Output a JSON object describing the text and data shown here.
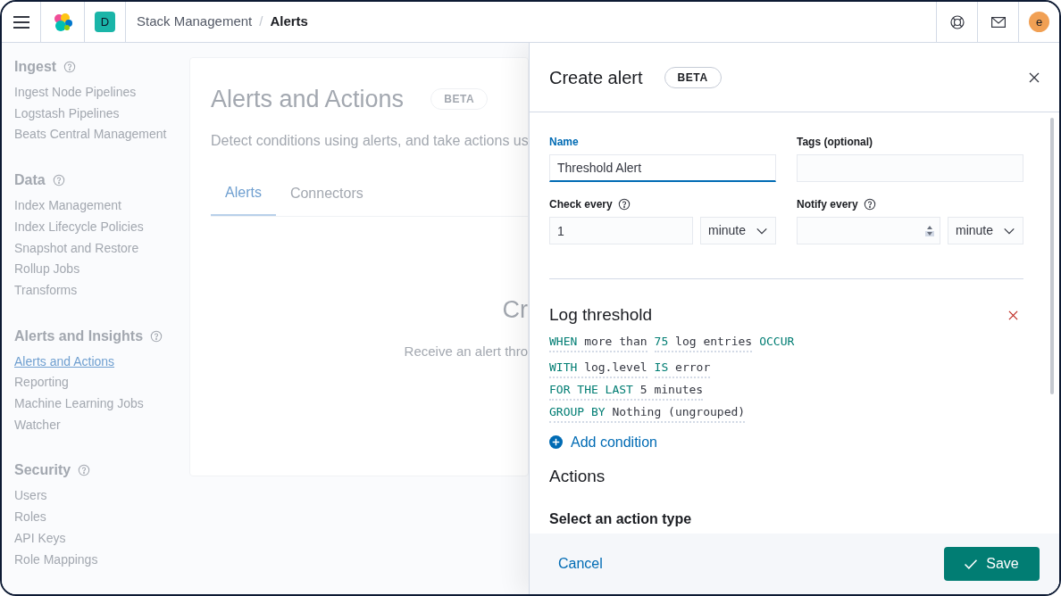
{
  "header": {
    "space_initial": "D",
    "breadcrumbs": [
      {
        "label": "Stack Management",
        "selected": false
      },
      {
        "label": "Alerts",
        "selected": true
      }
    ],
    "separator": "/",
    "avatar_initial": "e"
  },
  "sidebar": {
    "sections": [
      {
        "title": "Ingest",
        "items": [
          {
            "label": "Ingest Node Pipelines",
            "selected": false
          },
          {
            "label": "Logstash Pipelines",
            "selected": false
          },
          {
            "label": "Beats Central Management",
            "selected": false
          }
        ]
      },
      {
        "title": "Data",
        "items": [
          {
            "label": "Index Management",
            "selected": false
          },
          {
            "label": "Index Lifecycle Policies",
            "selected": false
          },
          {
            "label": "Snapshot and Restore",
            "selected": false
          },
          {
            "label": "Rollup Jobs",
            "selected": false
          },
          {
            "label": "Transforms",
            "selected": false
          }
        ]
      },
      {
        "title": "Alerts and Insights",
        "items": [
          {
            "label": "Alerts and Actions",
            "selected": true
          },
          {
            "label": "Reporting",
            "selected": false
          },
          {
            "label": "Machine Learning Jobs",
            "selected": false
          },
          {
            "label": "Watcher",
            "selected": false
          }
        ]
      },
      {
        "title": "Security",
        "items": [
          {
            "label": "Users",
            "selected": false
          },
          {
            "label": "Roles",
            "selected": false
          },
          {
            "label": "API Keys",
            "selected": false
          },
          {
            "label": "Role Mappings",
            "selected": false
          }
        ]
      }
    ]
  },
  "page": {
    "title": "Alerts and Actions",
    "badge": "BETA",
    "description": "Detect conditions using alerts, and take actions us",
    "tabs": [
      {
        "label": "Alerts",
        "selected": true
      },
      {
        "label": "Connectors",
        "selected": false
      }
    ],
    "empty_title": "Cr",
    "empty_text": "Receive an alert thro"
  },
  "flyout": {
    "title": "Create alert",
    "badge": "BETA",
    "name": {
      "label": "Name",
      "value": "Threshold Alert",
      "focused": true
    },
    "tags": {
      "label": "Tags (optional)"
    },
    "check_every": {
      "label": "Check every",
      "value": "1",
      "unit": "minute"
    },
    "notify_every": {
      "label": "Notify every",
      "unit": "minute"
    },
    "alert_type": {
      "title": "Log threshold",
      "conditions": [
        [
          {
            "kind": "clause",
            "segments": [
              {
                "text": "WHEN",
                "kind": "keyword"
              },
              {
                "text": "more than",
                "kind": "value"
              }
            ]
          },
          {
            "kind": "clause",
            "segments": [
              {
                "text": "75",
                "kind": "keyword"
              },
              {
                "text": "log entries",
                "kind": "value"
              }
            ]
          },
          {
            "kind": "plain",
            "segments": [
              {
                "text": "OCCUR",
                "kind": "keyword"
              }
            ]
          }
        ],
        [
          {
            "kind": "clause",
            "segments": [
              {
                "text": "WITH",
                "kind": "keyword"
              },
              {
                "text": "log.level",
                "kind": "value"
              }
            ]
          },
          {
            "kind": "clause",
            "segments": [
              {
                "text": "IS",
                "kind": "keyword"
              },
              {
                "text": "error",
                "kind": "value"
              }
            ]
          }
        ],
        [
          {
            "kind": "clause",
            "segments": [
              {
                "text": "FOR THE LAST",
                "kind": "keyword"
              },
              {
                "text": "5 minutes",
                "kind": "value"
              }
            ]
          }
        ],
        [
          {
            "kind": "clause",
            "segments": [
              {
                "text": "GROUP BY",
                "kind": "keyword"
              },
              {
                "text": "Nothing (ungrouped)",
                "kind": "value"
              }
            ]
          }
        ]
      ],
      "add_condition": "Add condition"
    },
    "actions_title": "Actions",
    "action_type_label": "Select an action type",
    "cancel": "Cancel",
    "save": "Save"
  }
}
